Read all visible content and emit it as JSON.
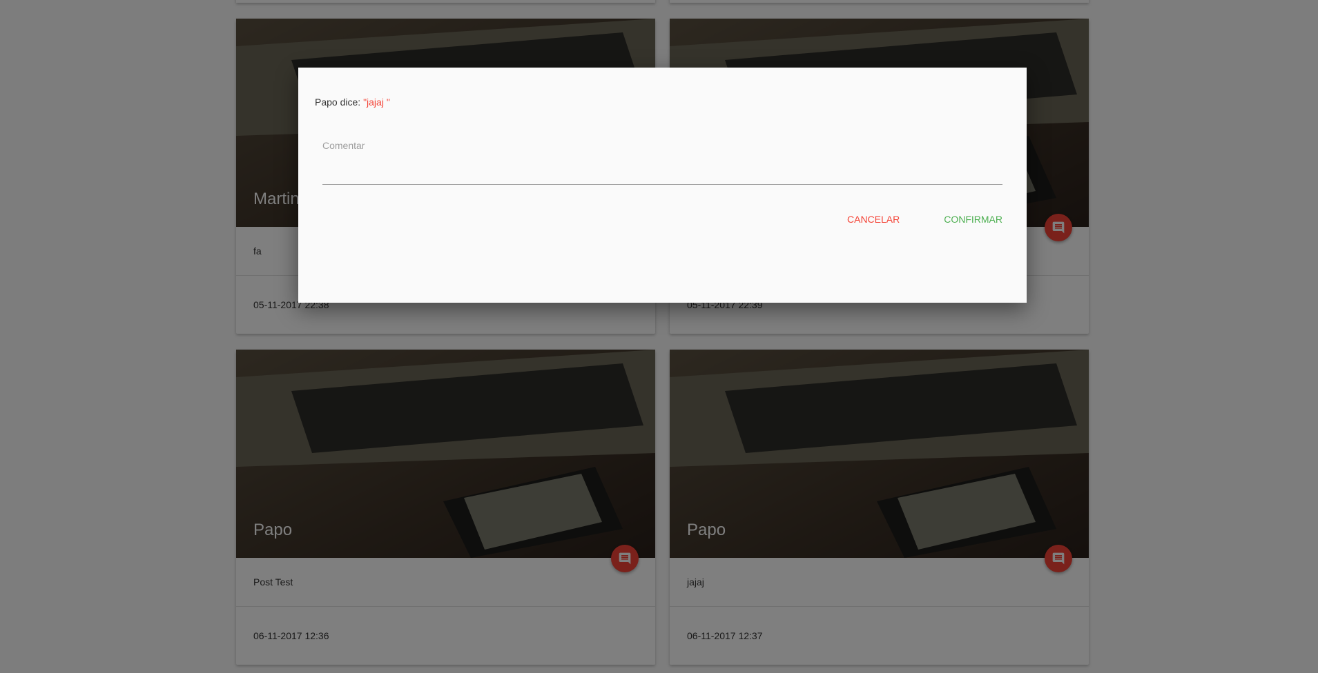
{
  "dialog": {
    "author": "Papo",
    "says_label": "dice:",
    "quote": "\"jajaj \"",
    "input_label": "Comentar",
    "input_value": "",
    "cancel_label": "CANCELAR",
    "confirm_label": "CONFIRMAR"
  },
  "cards": [
    {
      "title": "Martin",
      "body": "fa",
      "date": "05-11-2017 22:38"
    },
    {
      "title": "",
      "body": "",
      "date": "05-11-2017 22:39"
    },
    {
      "title": "Papo",
      "body": "Post Test",
      "date": "06-11-2017 12:36"
    },
    {
      "title": "Papo",
      "body": "jajaj",
      "date": "06-11-2017 12:37"
    }
  ],
  "colors": {
    "accent_red": "#f44336",
    "confirm_green": "#4caf50",
    "overlay": "rgba(0,0,0,0.5)"
  },
  "icons": {
    "fab": "comment-icon"
  }
}
